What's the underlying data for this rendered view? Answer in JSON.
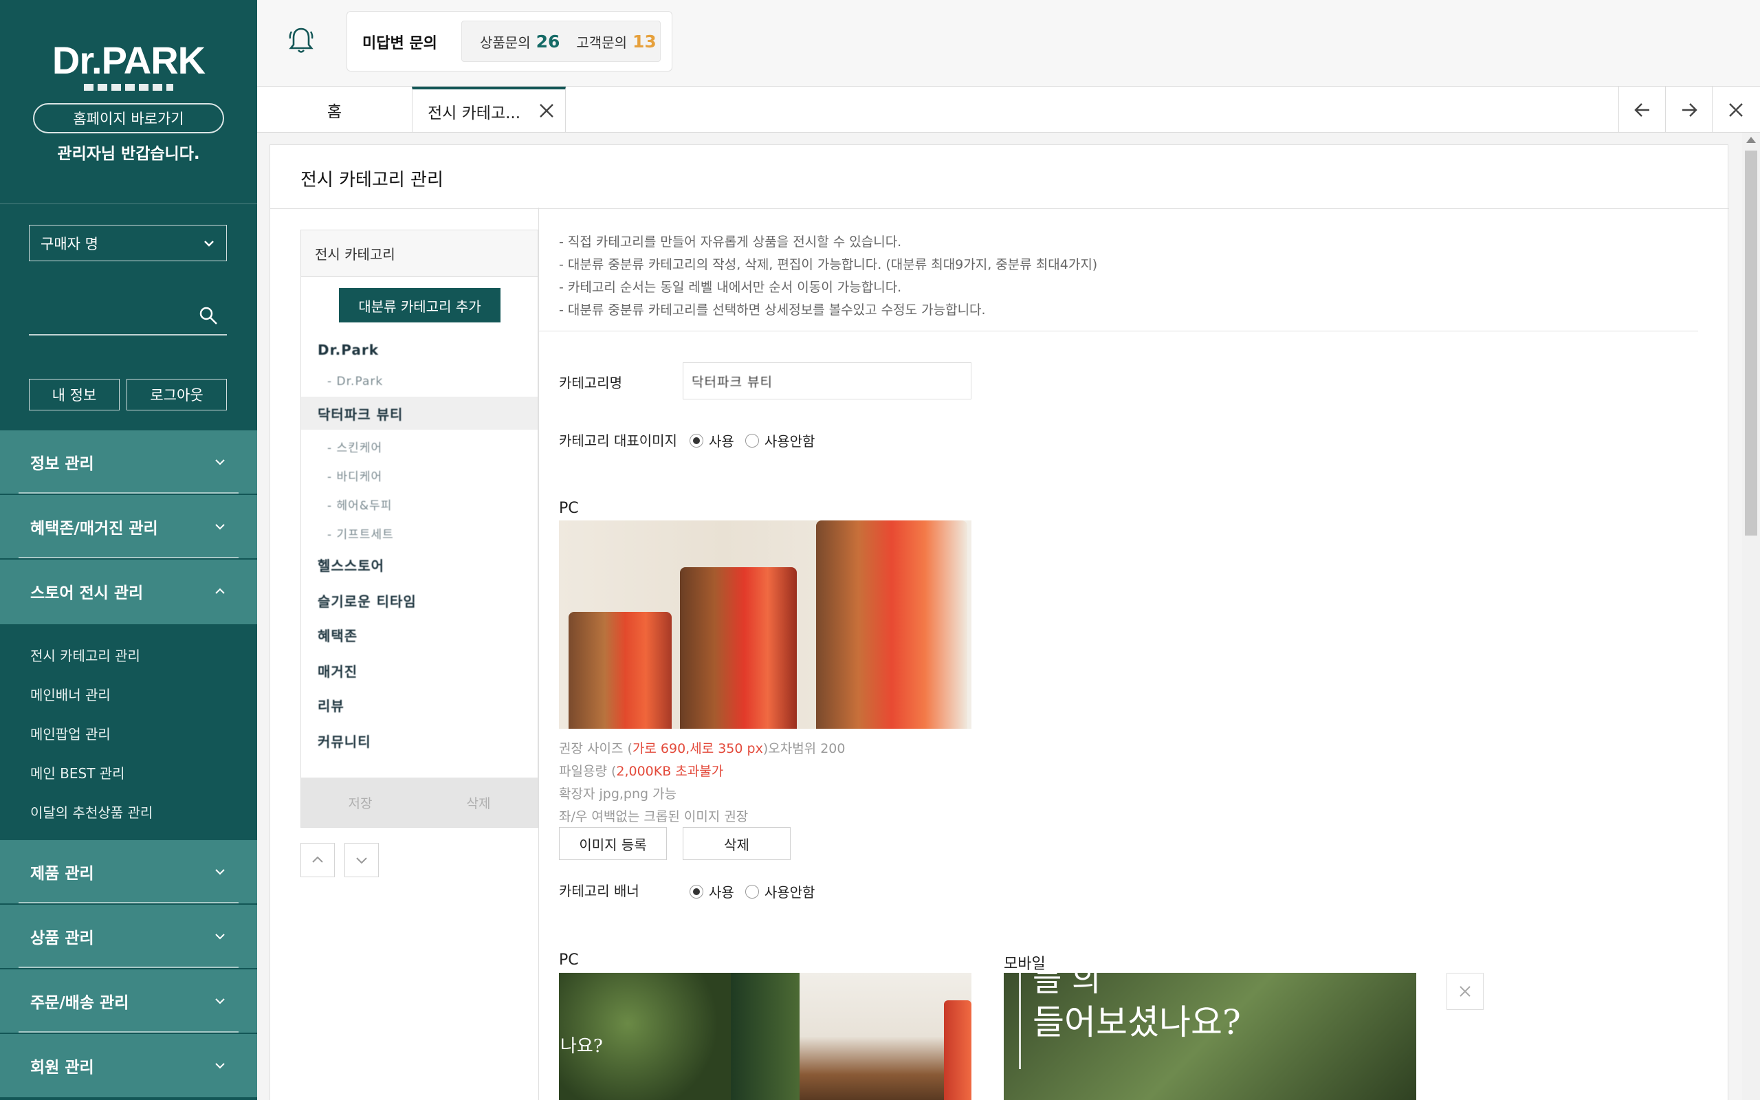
{
  "sidebar": {
    "logo_text": "Dr.PARK",
    "home_button": "홈페이지 바로가기",
    "welcome": "관리자님 반갑습니다.",
    "buyer_select": "구매자 명",
    "search_placeholder": "",
    "my_info": "내 정보",
    "logout": "로그아웃",
    "menu": [
      {
        "label": "정보 관리"
      },
      {
        "label": "혜택존/매거진 관리"
      },
      {
        "label": "스토어 전시 관리"
      },
      {
        "label": "제품 관리"
      },
      {
        "label": "상품 관리"
      },
      {
        "label": "주문/배송 관리"
      },
      {
        "label": "회원 관리"
      }
    ],
    "submenu": [
      "전시 카테고리 관리",
      "메인배너 관리",
      "메인팝업 관리",
      "메인 BEST 관리",
      "이달의 추천상품 관리"
    ]
  },
  "topbar": {
    "unanswered_title": "미답변 문의",
    "product_inquiry_label": "상품문의",
    "product_inquiry_count": "26",
    "customer_inquiry_label": "고객문의",
    "customer_inquiry_count": "13"
  },
  "tabs": {
    "home": "홈",
    "active": "전시 카테고..."
  },
  "main": {
    "title": "전시 카테고리 관리",
    "tree": {
      "header": "전시 카테고리",
      "add_button": "대분류 카테고리 추가",
      "items": [
        {
          "label": "Dr.Park",
          "level": 1
        },
        {
          "label": "- Dr.Park",
          "level": 2
        },
        {
          "label": "닥터파크 뷰티",
          "level": 1
        },
        {
          "label": "- 스킨케어",
          "level": 2
        },
        {
          "label": "- 바디케어",
          "level": 2
        },
        {
          "label": "- 헤어&두피",
          "level": 2
        },
        {
          "label": "- 기프트세트",
          "level": 2
        },
        {
          "label": "헬스스토어",
          "level": 1
        },
        {
          "label": "슬기로운 티타임",
          "level": 1
        },
        {
          "label": "혜택존",
          "level": 1
        },
        {
          "label": "매거진",
          "level": 1
        },
        {
          "label": "리뷰",
          "level": 1
        },
        {
          "label": "커뮤니티",
          "level": 1
        }
      ],
      "save": "저장",
      "delete": "삭제"
    },
    "info": [
      "- 직접 카테고리를 만들어 자유롭게 상품을 전시할 수 있습니다.",
      "- 대분류 중분류 카테고리의 작성, 삭제, 편집이 가능합니다. (대분류 최대9가지, 중분류 최대4가지)",
      "- 카테고리 순서는 동일 레벨 내에서만 순서 이동이 가능합니다.",
      "- 대분류 중분류 카테고리를 선택하면 상세정보를 볼수있고 수정도 가능합니다."
    ],
    "category_name_label": "카테고리명",
    "category_name_value": "닥터파크 뷰티",
    "rep_image_label": "카테고리 대표이미지",
    "use": "사용",
    "not_use": "사용안함",
    "pc_label": "PC",
    "hint": {
      "size_prefix": "권장 사이즈 (",
      "size_value": "가로 690,세로 350 px",
      "size_suffix": ")오차범위 200",
      "file_prefix": "파일용량 (",
      "file_value": "2,000KB 초과불가",
      "ext": "확장자 jpg,png 가능",
      "crop": "좌/우 여백없는 크롭된 이미지 권장"
    },
    "register_image": "이미지 등록",
    "delete_image": "삭제",
    "banner_label": "카테고리 배너",
    "banner_pc_label": "PC",
    "banner_mobile_label": "모바일",
    "banner_pc_text": "나요?",
    "banner_mobile_text_top": "들 의",
    "banner_mobile_text": "들어보셨나요?"
  },
  "colors": {
    "sidebar_bg": "#135656",
    "menu_group_bg": "#3e8784",
    "accent_orange": "#e6a03b",
    "hint_red": "#e34a3b"
  }
}
